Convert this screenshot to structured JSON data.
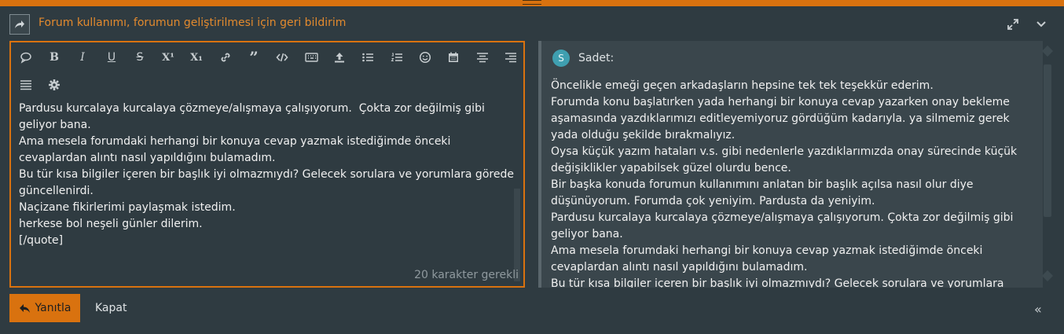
{
  "header": {
    "title": "Forum kullanımı, forumun geliştirilmesi için geri bildirim"
  },
  "toolbar": {
    "icons": [
      "speech-bubble-icon",
      "bold-icon",
      "italic-icon",
      "underline-icon",
      "strikethrough-icon",
      "superscript-icon",
      "subscript-icon",
      "link-icon",
      "quote-icon",
      "code-icon",
      "keyboard-icon",
      "upload-icon",
      "bullet-list-icon",
      "numbered-list-icon",
      "emoji-icon",
      "calendar-icon",
      "align-center-icon",
      "align-right-icon",
      "align-justify-icon",
      "gear-icon"
    ],
    "bold": "B",
    "italic": "I",
    "underline": "U",
    "strike": "S",
    "sup": "X¹",
    "sub": "X₁"
  },
  "editor": {
    "text": "Pardusu kurcalaya kurcalaya çözmeye/alışmaya çalışıyorum.  Çokta zor değilmiş gibi geliyor bana.\nAma mesela forumdaki herhangi bir konuya cevap yazmak istediğimde önceki cevaplardan alıntı nasıl yapıldığını bulamadım.\nBu tür kısa bilgiler içeren bir başlık iyi olmazmıydı? Gelecek sorulara ve yorumlara görede güncellenirdi.\nNaçizane fikirlerimi paylaşmak istedim.\nherkese bol neşeli günler dilerim.\n[/quote]",
    "counter": "20 karakter gerekli"
  },
  "preview": {
    "avatar_letter": "S",
    "author": "Sadet:",
    "text": "Öncelikle emeği geçen arkadaşların hepsine tek tek teşekkür ederim.\nForumda konu başlatırken yada herhangi bir konuya cevap yazarken onay bekleme aşamasında yazdıklarımızı editleyemiyoruz gördüğüm kadarıyla. ya silmemiz gerek yada olduğu şekilde bırakmalıyız.\nOysa küçük yazım hataları v.s. gibi nedenlerle yazdıklarımızda onay sürecinde küçük değişiklikler yapabilsek güzel olurdu bence.\nBir başka konuda forumun kullanımını anlatan bir başlık açılsa nasıl olur diye düşünüyorum. Forumda çok yeniyim. Pardusta da yeniyim.\nPardusu kurcalaya kurcalaya çözmeye/alışmaya çalışıyorum. Çokta zor değilmiş gibi geliyor bana.\nAma mesela forumdaki herhangi bir konuya cevap yazmak istediğimde önceki cevaplardan alıntı nasıl yapıldığını bulamadım.\nBu tür kısa bilgiler içeren bir başlık iyi olmazmıydı? Gelecek sorulara ve yorumlara"
  },
  "footer": {
    "reply_label": "Yanıtla",
    "close_label": "Kapat",
    "collapse_glyph": "«"
  },
  "colors": {
    "accent": "#d9720f",
    "background": "#2f3b41",
    "preview_bg": "#3a464c"
  }
}
